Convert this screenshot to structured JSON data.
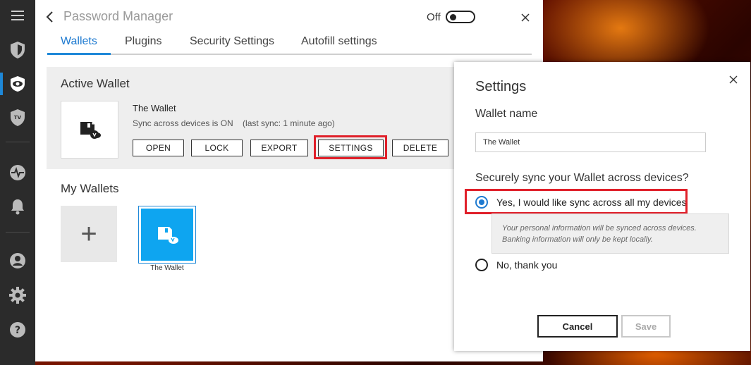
{
  "app": {
    "title": "Password Manager",
    "toggle_label": "Off",
    "toggle_state": "off"
  },
  "rail": {
    "items": [
      {
        "icon": "hamburger-menu-icon"
      },
      {
        "icon": "shield-icon"
      },
      {
        "icon": "eye-shield-icon",
        "active": true
      },
      {
        "icon": "tv-shield-icon"
      },
      {
        "icon": "activity-icon"
      },
      {
        "icon": "bell-icon"
      },
      {
        "icon": "user-icon"
      },
      {
        "icon": "gear-icon"
      },
      {
        "icon": "help-icon"
      }
    ]
  },
  "tabs": [
    {
      "label": "Wallets",
      "active": true
    },
    {
      "label": "Plugins"
    },
    {
      "label": "Security Settings"
    },
    {
      "label": "Autofill settings"
    }
  ],
  "active_wallet": {
    "heading": "Active Wallet",
    "name": "The Wallet",
    "sync_status": "Sync across devices is ON    (last sync: 1 minute ago)",
    "buttons": {
      "open": "OPEN",
      "lock": "LOCK",
      "export": "EXPORT",
      "settings": "SETTINGS",
      "delete": "DELETE"
    }
  },
  "my_wallets": {
    "heading": "My Wallets",
    "add_symbol": "+",
    "items": [
      {
        "label": "The Wallet"
      }
    ]
  },
  "settings_dialog": {
    "title": "Settings",
    "wallet_name_label": "Wallet name",
    "wallet_name_value": "The Wallet",
    "sync_question": "Securely sync your Wallet across devices?",
    "option_yes": "Yes, I would like sync across all my devices",
    "option_yes_selected": true,
    "info_line1": "Your personal information will be synced across devices.",
    "info_line2": "Banking information will only be kept locally.",
    "option_no": "No, thank you",
    "cancel_label": "Cancel",
    "save_label": "Save"
  },
  "colors": {
    "accent": "#1e88d8",
    "highlight": "#e0202a",
    "rail_bg": "#2b2b2b",
    "tile_blue": "#0ea5f0"
  }
}
